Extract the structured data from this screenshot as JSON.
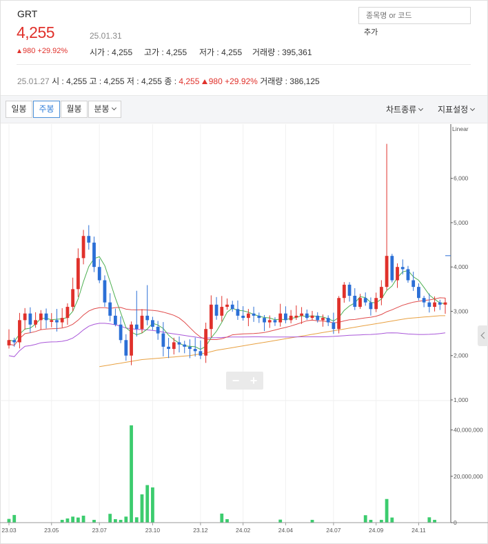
{
  "header": {
    "name": "GRT",
    "price": "4,255",
    "date": "25.01.31",
    "change_value": "980",
    "change_pct": "+29.92%",
    "open": "시가 : 4,255",
    "high": "고가 : 4,255",
    "low": "저가 : 4,255",
    "volume": "거래량 : 395,361"
  },
  "search": {
    "placeholder": "종목명 or 코드",
    "add_label": "추가"
  },
  "daily_bar": {
    "date": "25.01.27",
    "open": "시 : 4,255",
    "high": "고 : 4,255",
    "low": "저 : 4,255",
    "close_label": "종 : ",
    "close": "4,255",
    "change": "980",
    "pct": "+29.92%",
    "volume": "거래량 : 386,125"
  },
  "toolbar": {
    "tabs": [
      "일봉",
      "주봉",
      "월봉",
      "분봉"
    ],
    "active_tab": "주봉",
    "chart_type": "차트종류",
    "indicator": "지표설정"
  },
  "colors": {
    "up": "#e0312b",
    "down": "#2b6fd6",
    "ma5": "#4caf50",
    "ma20": "#e04a4a",
    "ma60": "#a855d8",
    "ma120": "#e8a040",
    "volume": "#3ccc6e"
  },
  "chart_data": {
    "type": "candlestick",
    "scale_label": "Linear",
    "x_ticks": [
      "23.03",
      "23.05",
      "23.07",
      "23.10",
      "23.12",
      "24.02",
      "24.04",
      "24.07",
      "24.09",
      "24.11"
    ],
    "x_tick_index": [
      0,
      8,
      17,
      27,
      36,
      44,
      52,
      61,
      69,
      77
    ],
    "price_ticks": [
      1000,
      2000,
      3000,
      4000,
      5000,
      6000
    ],
    "price_tick_labels": [
      "1,000",
      "2,000",
      "3,000",
      "4,000",
      "5,000",
      "6,000"
    ],
    "price_range": [
      1000,
      7100
    ],
    "volume_ticks": [
      0,
      20000000,
      40000000
    ],
    "volume_tick_labels": [
      "0",
      "20,000,000",
      "40,000,000"
    ],
    "volume_range": [
      0,
      50000000
    ],
    "closes": [
      2350,
      2300,
      2800,
      2950,
      2700,
      2800,
      2950,
      2800,
      2800,
      2750,
      2850,
      3100,
      3500,
      4200,
      4700,
      4550,
      4000,
      3700,
      3200,
      2900,
      2700,
      2350,
      2000,
      2700,
      2600,
      2900,
      2800,
      2650,
      2500,
      2200,
      2150,
      2300,
      2250,
      2200,
      2150,
      2100,
      2000,
      2600,
      3150,
      2900,
      3100,
      3150,
      3050,
      2900,
      2850,
      2950,
      2900,
      2850,
      2750,
      2800,
      2750,
      2950,
      2800,
      2900,
      2900,
      2950,
      2850,
      2900,
      2800,
      2850,
      2750,
      2600,
      3300,
      3600,
      3350,
      3100,
      3300,
      3200,
      3050,
      3300,
      3550,
      4250,
      3700,
      4000,
      3950,
      3700,
      3550,
      3300,
      3200,
      3100,
      3200,
      3150,
      3200
    ],
    "volumes": [
      1600000,
      3300000,
      0,
      0,
      0,
      0,
      0,
      0,
      0,
      0,
      1200000,
      1800000,
      2600000,
      2200000,
      3000000,
      0,
      1200000,
      0,
      0,
      3800000,
      1500000,
      1200000,
      2600000,
      42000000,
      2300000,
      12200000,
      16200000,
      15200000,
      0,
      0,
      0,
      0,
      0,
      0,
      0,
      0,
      0,
      0,
      0,
      0,
      3900000,
      1500000,
      0,
      0,
      0,
      0,
      0,
      0,
      0,
      0,
      0,
      1300000,
      0,
      0,
      0,
      0,
      0,
      1200000,
      0,
      0,
      0,
      0,
      0,
      0,
      0,
      0,
      0,
      3200000,
      1200000,
      0,
      1200000,
      10200000,
      2200000,
      0,
      0,
      0,
      0,
      0,
      0,
      2300000,
      1200000,
      0,
      0
    ],
    "ma120": [
      null,
      null,
      null,
      null,
      null,
      null,
      null,
      null,
      null,
      null,
      null,
      null,
      null,
      null,
      null,
      null,
      null,
      1750,
      1770,
      1790,
      1810,
      1830,
      1850,
      1870,
      1890,
      1910,
      1920,
      1930,
      1940,
      1950,
      1960,
      1970,
      1980,
      1990,
      2000,
      2020,
      2040,
      2060,
      2090,
      2120,
      2140,
      2160,
      2180,
      2200,
      2220,
      2240,
      2260,
      2280,
      2300,
      2320,
      2340,
      2360,
      2380,
      2400,
      2420,
      2440,
      2460,
      2480,
      2500,
      2520,
      2540,
      2560,
      2580,
      2600,
      2620,
      2640,
      2660,
      2680,
      2700,
      2720,
      2740,
      2760,
      2780,
      2800,
      2820,
      2840,
      2850,
      2860,
      2870,
      2880,
      2890,
      2900,
      2900
    ]
  }
}
